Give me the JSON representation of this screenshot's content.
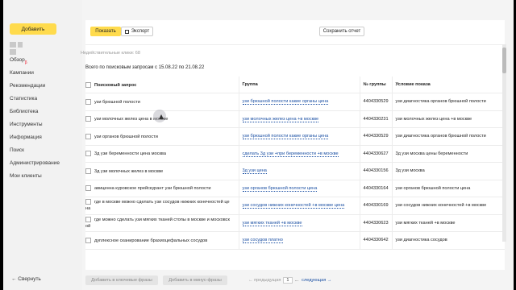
{
  "sidebar": {
    "add_label": "Добавить",
    "items": [
      {
        "label": "Обзор",
        "badge": "β"
      },
      {
        "label": "Кампании"
      },
      {
        "label": "Рекомендации"
      },
      {
        "label": "Статистика"
      },
      {
        "label": "Библиотека"
      },
      {
        "label": "Инструменты"
      },
      {
        "label": "Информация"
      },
      {
        "label": "Поиск"
      },
      {
        "label": "Администрирование"
      },
      {
        "label": "Мои клиенты"
      }
    ],
    "collapse_label": "← Свернуть"
  },
  "toolbar": {
    "show_label": "Показать",
    "export_label": "Экспорт",
    "save_report_label": "Сохранить отчет"
  },
  "invalid_clicks": "Недействительные клики: 68",
  "period_text": "Всего по поисковым запросам с 15.08.22 по 21.08.22",
  "table": {
    "headers": {
      "query": "Поисковый запрос",
      "group": "Группа",
      "group_no": "№ группы",
      "condition": "Условие показа"
    },
    "rows": [
      {
        "query": "узи брюшной полости",
        "group": "узи брюшной полости какие органы цена",
        "no": "4404330529",
        "cond": "узи диагностика органов брюшной полости"
      },
      {
        "query": "узи молочных желез цена в москве",
        "group": "узи молочных желез цена +в москве",
        "no": "4404330231",
        "cond": "узи молочных желез цена +в москве"
      },
      {
        "query": "узи органов брюшной полости",
        "group": "узи брюшной полости какие органы цена",
        "no": "4404330529",
        "cond": "узи диагностика органов брюшной полости"
      },
      {
        "query": "3д узи беременности цена москва",
        "group": "сделать 3д узи +при беременности +в москве",
        "no": "4404330627",
        "cond": "3д узи москва цены беременности"
      },
      {
        "query": "3д узи молочных желез в москве",
        "group": "3д узи цена",
        "no": "4404330156",
        "cond": "3д узи москва"
      },
      {
        "query": "авиценна куровское прейскурант узи брюшной полости",
        "group": "узи органов брюшной полости цена",
        "no": "4404330164",
        "cond": "узи органов брюшной полости цена"
      },
      {
        "query": "где в москве можно сделать узи сосудов нижних конечностей це на",
        "group": "узи сосудов нижних конечностей +в москве цена",
        "no": "4404330169",
        "cond": "узи сосудов нижних конечностей +в москве"
      },
      {
        "query": "где можно сделать узи мягких тканей стопы в москве и московск ой",
        "group": "узи мягких тканей +в москве",
        "no": "4404330623",
        "cond": "узи мягких тканей +в москве"
      },
      {
        "query": "дуплексное сканирование брахиоцефальных сосудов",
        "group": "узи сосудов платно",
        "no": "4404330642",
        "cond": "узи диагностика сосудов"
      }
    ]
  },
  "bottom": {
    "add_keywords": "Добавить в ключевые фразы",
    "add_minus": "Добавить в минус-фразы",
    "prev": "← предыдущая",
    "page": "1",
    "ellipsis": "...",
    "next": "следующая →"
  }
}
